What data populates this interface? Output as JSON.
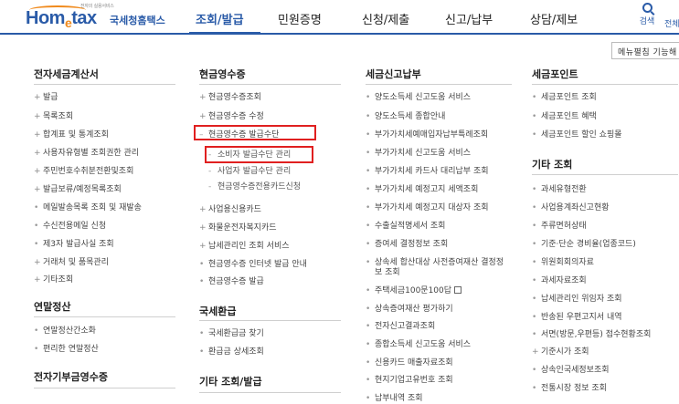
{
  "header": {
    "logo_tagline": "전자의 실용서비스",
    "logo_home": "Hom",
    "logo_e": "e",
    "logo_tax": "tax",
    "logo_sub": "국세청홈택스",
    "nav": [
      "조회/발급",
      "민원증명",
      "신청/제출",
      "신고/납부",
      "상담/제보"
    ],
    "active_nav": "조회/발급",
    "search_label": "검색",
    "all_label": "전체",
    "fav_button": "메뉴펼침 기능해"
  },
  "columns": {
    "c1": {
      "s1": {
        "title": "전자세금계산서",
        "items": [
          "발급",
          "목록조회",
          "합계표 및 통계조회",
          "사용자유형별 조회권한 관리",
          "주민번호수취분전환및조회",
          "발급보류/예정목록조회",
          "메일발송목록 조회 및 재발송",
          "수신전용메일 신청",
          "제3자 발급사실 조회",
          "거래처 및 품목관리",
          "기타조회"
        ]
      },
      "s2": {
        "title": "연말정산",
        "items": [
          "연말정산간소화",
          "편리한 연말정산"
        ]
      },
      "s3": {
        "title": "전자기부금영수증"
      }
    },
    "c2": {
      "s1": {
        "title": "현금영수증",
        "items": [
          "현금영수증조회",
          "현금영수증 수정",
          "현금영수증 발급수단",
          "소비자 발급수단 관리",
          "사업자 발급수단 관리",
          "현금영수증전용카드신청",
          "사업용신용카드",
          "화물운전자복지카드",
          "납세관리인 조회 서비스",
          "현금영수증 인터넷 발급 안내",
          "현금영수증 발급"
        ]
      },
      "s2": {
        "title": "국세환급",
        "items": [
          "국세환급금 찾기",
          "환급금 상세조회"
        ]
      },
      "s3": {
        "title": "기타 조회/발급"
      }
    },
    "c3": {
      "s1": {
        "title": "세금신고납부",
        "items": [
          "양도소득세 신고도움 서비스",
          "양도소득세 종합안내",
          "부가가치세예매입자납부특례조회",
          "부가가치세 신고도움 서비스",
          "부가가치세 카드사 대리납부 조회",
          "부가가치세 예정고지 세액조회",
          "부가가치세 예정고지 대상자 조회",
          "수출실적명세서 조회",
          "증여세 결정정보 조회",
          "상속세 합산대상 사전증여재산 결정정",
          "보 조회",
          "주택세금100문100답",
          "상속증여재산 평가하기",
          "전자신고결과조회",
          "종합소득세 신고도움 서비스",
          "신용카드 매출자료조회",
          "현지기업고유번호 조회",
          "납부내역 조회"
        ]
      }
    },
    "c4": {
      "s1": {
        "title": "세금포인트",
        "items": [
          "세금포인트 조회",
          "세금포인트 혜택",
          "세금포인트 할인 쇼핑몰"
        ]
      },
      "s2": {
        "title": "기타 조회",
        "items": [
          "과세유형전환",
          "사업용계좌신고현황",
          "주류면허상태",
          "기준·단순 경비율(업종코드)",
          "위원회회의자료",
          "과세자료조회",
          "납세관리인 위임자 조회",
          "반송된 우편고지서 내역",
          "서면(방문,우편등) 접수현황조회",
          "기준시가 조회",
          "상속인국세정보조회",
          "전통시장 정보 조회"
        ]
      }
    }
  },
  "colors": {
    "brand": "#2a5ba8",
    "accent": "#f08a1c",
    "highlight": "#e02020"
  }
}
